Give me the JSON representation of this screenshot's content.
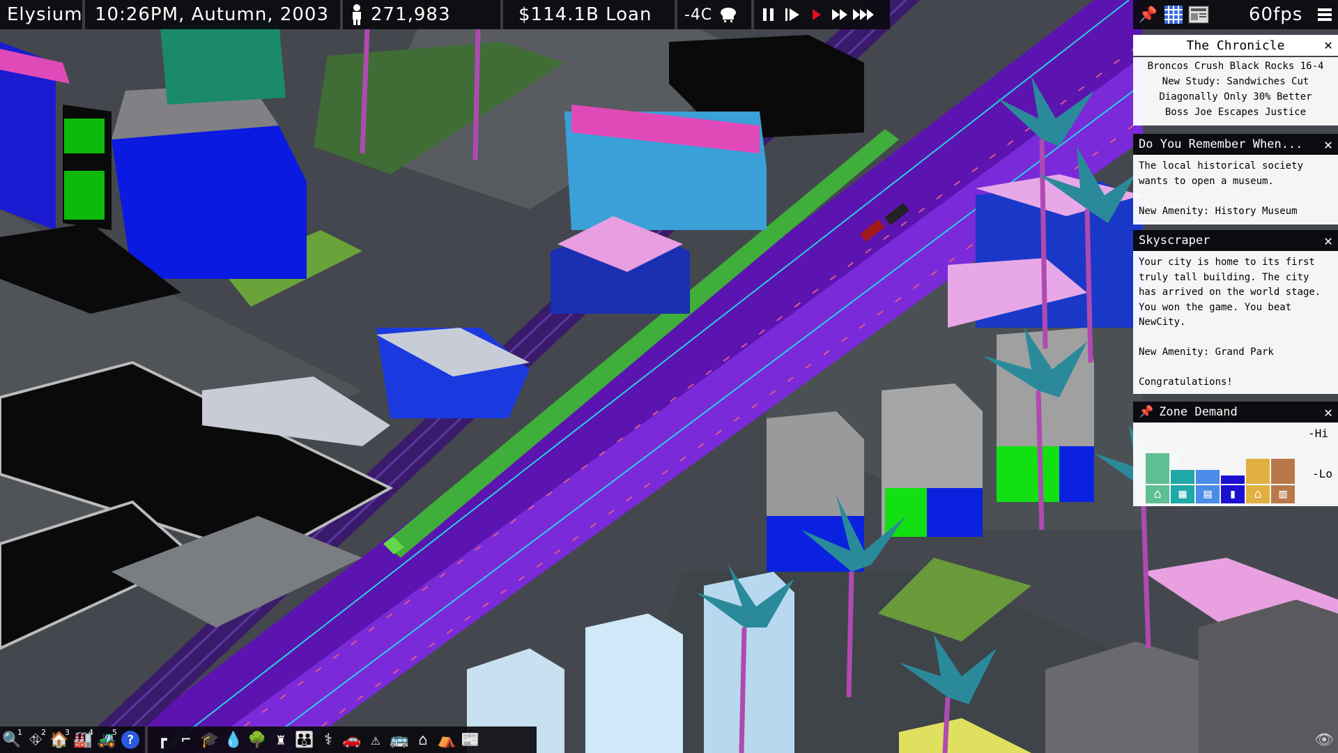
{
  "topbar": {
    "city": "Elysium",
    "datetime": "10:26PM, Autumn, 2003",
    "population": "271,983",
    "money": "$114.1B Loan",
    "temperature": "-4C",
    "fps": "60fps",
    "icons": {
      "population": "person-icon",
      "weather": "snow-cloud-icon",
      "pause": "pause-icon",
      "play": "play-icon",
      "record": "record-icon",
      "fast": "fast-forward-icon",
      "fastest": "fastest-forward-icon",
      "pin": "pin-icon",
      "grid": "grid-icon",
      "newspaper": "newspaper-icon",
      "menu": "menu-icon"
    },
    "active_speed_color": "#e01020"
  },
  "chronicle": {
    "title": "The Chronicle",
    "headlines": [
      "Broncos Crush Black Rocks 16-4",
      "New Study: Sandwiches Cut",
      "Diagonally Only 30% Better",
      "Boss Joe Escapes Justice"
    ]
  },
  "notifications": [
    {
      "title": "Do You Remember When...",
      "body": "The local historical society wants to open a museum.\n\nNew Amenity: History Museum"
    },
    {
      "title": "Skyscraper",
      "body": "Your city is home to its first truly tall building. The city has arrived on the world stage. You won the game. You beat NewCity.\n\nNew Amenity: Grand Park\n\nCongratulations!"
    }
  ],
  "zone_demand": {
    "title": "Zone Demand",
    "hi_label": "-Hi",
    "lo_label": "-Lo",
    "bars": [
      {
        "icon": "house-icon",
        "color": "#5fbf94",
        "level": 0.55
      },
      {
        "icon": "apartment-icon",
        "color": "#1fa8a8",
        "level": 0.25
      },
      {
        "icon": "office-icon",
        "color": "#4a8ce8",
        "level": 0.25
      },
      {
        "icon": "tower-icon",
        "color": "#1a10d0",
        "level": 0.15
      },
      {
        "icon": "shop-icon",
        "color": "#e0b040",
        "level": 0.45
      },
      {
        "icon": "factory-icon",
        "color": "#b8784a",
        "level": 0.45
      }
    ]
  },
  "bottom_toolbar": {
    "tools": [
      {
        "icon": "search-icon",
        "sup": "1"
      },
      {
        "icon": "road-icon",
        "sup": "2"
      },
      {
        "icon": "zone-residential-icon",
        "sup": "3"
      },
      {
        "icon": "zone-industrial-icon",
        "sup": "4"
      },
      {
        "icon": "bulldozer-icon",
        "sup": "5"
      },
      {
        "icon": "help-icon",
        "sup": ""
      }
    ],
    "amenities": [
      "streetlight-icon",
      "gun-icon",
      "graduation-cap-icon",
      "water-icon",
      "park-icon",
      "monument-icon",
      "people-icon",
      "medical-icon",
      "car-icon",
      "warning-icon",
      "bus-icon",
      "home-icon",
      "shelter-icon",
      "newspaper-icon"
    ]
  }
}
